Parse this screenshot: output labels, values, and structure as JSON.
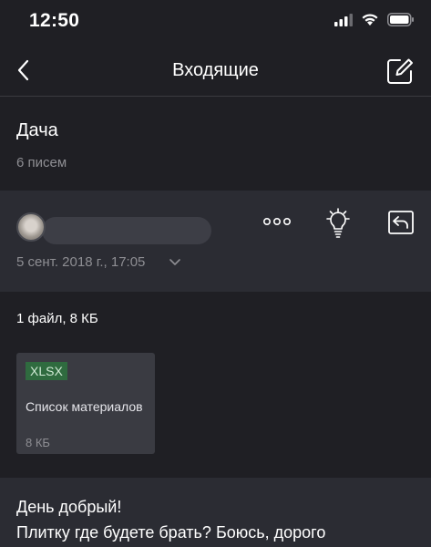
{
  "status_bar": {
    "time": "12:50",
    "icons": [
      "cellular-signal-icon",
      "wifi-icon",
      "battery-icon"
    ]
  },
  "nav": {
    "title": "Входящие",
    "back_icon": "chevron-left-icon",
    "compose_icon": "compose-icon"
  },
  "thread": {
    "subject": "Дача",
    "count": "6 писем"
  },
  "message": {
    "date": "5 сент. 2018 г., 17:05",
    "actions": [
      "more-icon",
      "lightbulb-icon",
      "reply-icon"
    ]
  },
  "attachments": {
    "summary": "1 файл, 8 КБ",
    "files": [
      {
        "ext": "XLSX",
        "name": "Список материалов",
        "size": "8 КБ"
      }
    ]
  },
  "body": {
    "line1": "День добрый!",
    "line2": "Плитку где будете брать? Боюсь, дорого"
  },
  "colors": {
    "background": "#1f1f24",
    "panel": "#2b2c33",
    "secondary_text": "#8e8e93",
    "xlsx_badge": "#2f6b3f"
  }
}
